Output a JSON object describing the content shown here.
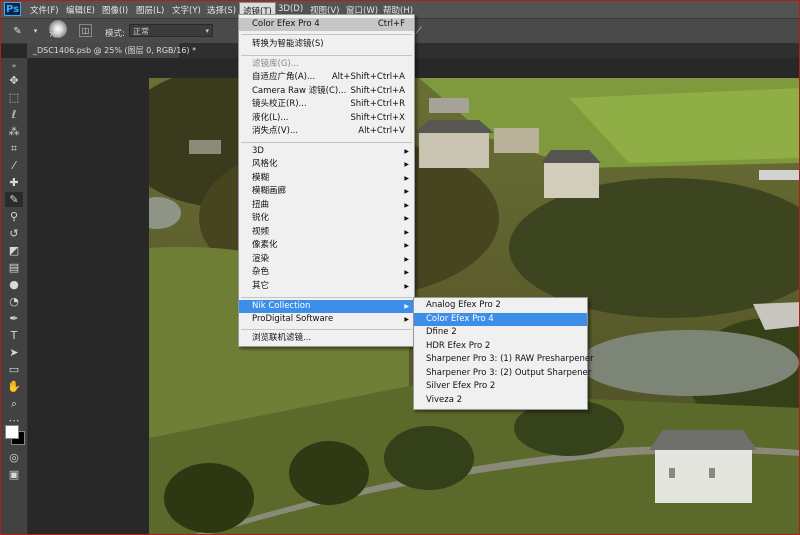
{
  "app": {
    "logo": "Ps"
  },
  "menubar": [
    {
      "label": "文件(F)"
    },
    {
      "label": "编辑(E)"
    },
    {
      "label": "图像(I)"
    },
    {
      "label": "图层(L)"
    },
    {
      "label": "文字(Y)"
    },
    {
      "label": "选择(S)"
    },
    {
      "label": "滤镜(T)"
    },
    {
      "label": "3D(D)"
    },
    {
      "label": "视图(V)"
    },
    {
      "label": "窗口(W)"
    },
    {
      "label": "帮助(H)"
    }
  ],
  "options": {
    "brush_size": "700",
    "mode_label": "模式:",
    "mode_value": "正常"
  },
  "document": {
    "tab_title": "_DSC1406.psb @ 25% (图层 0, RGB/16) *",
    "close": "×"
  },
  "filter_menu": {
    "items": [
      {
        "label": "Color Efex Pro 4",
        "shortcut": "Ctrl+F"
      },
      {
        "label": "转换为智能滤镜(S)"
      },
      {
        "label": "滤镜库(G)...",
        "disabled": true
      },
      {
        "label": "自适应广角(A)...",
        "shortcut": "Alt+Shift+Ctrl+A"
      },
      {
        "label": "Camera Raw 滤镜(C)...",
        "shortcut": "Shift+Ctrl+A"
      },
      {
        "label": "镜头校正(R)...",
        "shortcut": "Shift+Ctrl+R"
      },
      {
        "label": "液化(L)...",
        "shortcut": "Shift+Ctrl+X"
      },
      {
        "label": "消失点(V)...",
        "shortcut": "Alt+Ctrl+V"
      },
      {
        "label": "3D",
        "submenu": true
      },
      {
        "label": "风格化",
        "submenu": true
      },
      {
        "label": "模糊",
        "submenu": true
      },
      {
        "label": "模糊画廊",
        "submenu": true
      },
      {
        "label": "扭曲",
        "submenu": true
      },
      {
        "label": "锐化",
        "submenu": true
      },
      {
        "label": "视频",
        "submenu": true
      },
      {
        "label": "像素化",
        "submenu": true
      },
      {
        "label": "渲染",
        "submenu": true
      },
      {
        "label": "杂色",
        "submenu": true
      },
      {
        "label": "其它",
        "submenu": true
      },
      {
        "label": "Nik Collection",
        "submenu": true
      },
      {
        "label": "ProDigital Software",
        "submenu": true
      },
      {
        "label": "浏览联机滤镜..."
      }
    ]
  },
  "nik_submenu": {
    "items": [
      {
        "label": "Analog Efex Pro 2"
      },
      {
        "label": "Color Efex Pro 4"
      },
      {
        "label": "Dfine 2"
      },
      {
        "label": "HDR Efex Pro 2"
      },
      {
        "label": "Sharpener Pro 3: (1) RAW Presharpener"
      },
      {
        "label": "Sharpener Pro 3: (2) Output Sharpener"
      },
      {
        "label": "Silver Efex Pro 2"
      },
      {
        "label": "Viveza 2"
      }
    ]
  },
  "colors": {
    "highlight": "#3d8ee8",
    "menu_bg": "#f0f0f0",
    "window_border": "#b01e1e"
  }
}
